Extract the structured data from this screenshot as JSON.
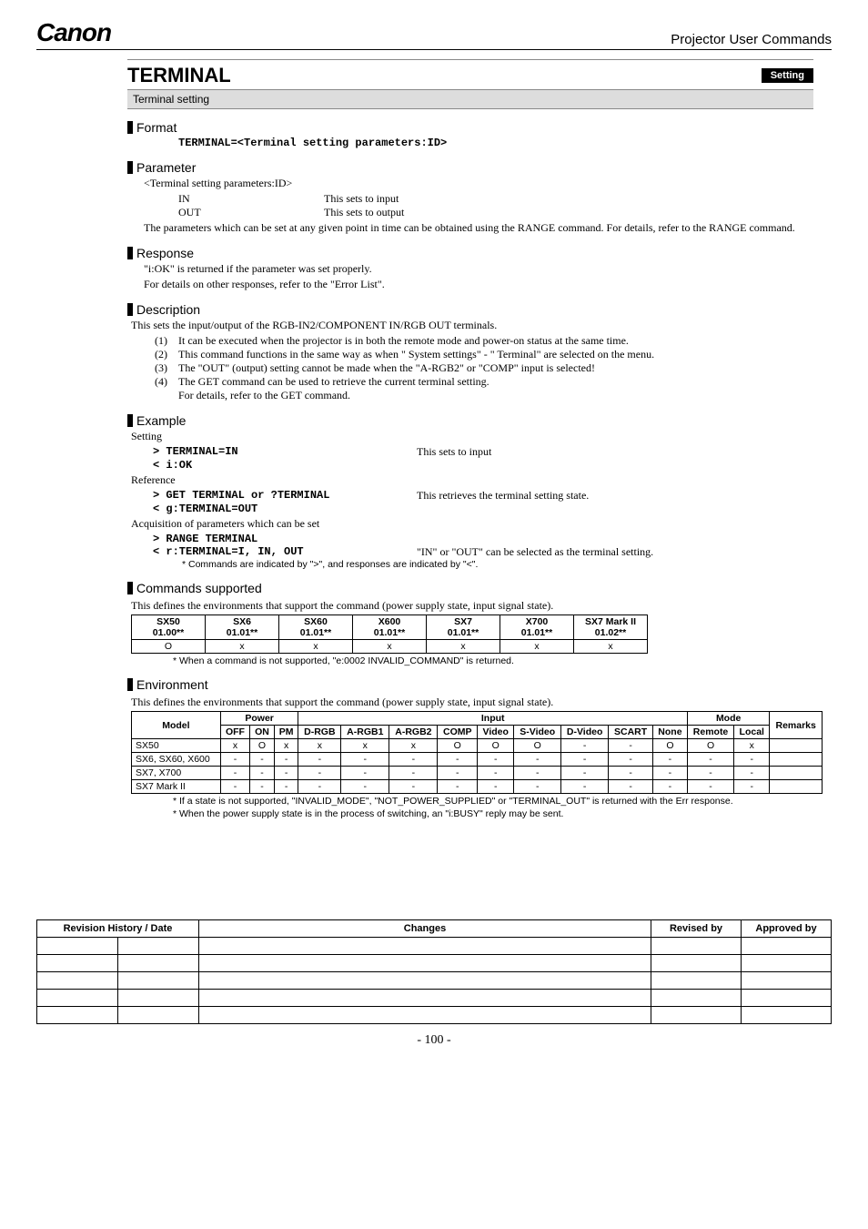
{
  "header": {
    "brand": "Canon",
    "docTitle": "Projector User Commands"
  },
  "titleBar": {
    "title": "TERMINAL",
    "badge": "Setting"
  },
  "subtitle": "Terminal setting",
  "format": {
    "heading": "Format",
    "code": "TERMINAL=<Terminal setting parameters:ID>"
  },
  "parameter": {
    "heading": "Parameter",
    "lead": "<Terminal setting parameters:ID>",
    "rows": [
      {
        "k": "IN",
        "v": "This sets to input"
      },
      {
        "k": "OUT",
        "v": "This sets to output"
      }
    ],
    "note": "The parameters which can be set at any given point in time can be obtained using the RANGE command. For details, refer to the RANGE command."
  },
  "response": {
    "heading": "Response",
    "l1": "\"i:OK\" is returned if the parameter was set properly.",
    "l2": "For details on other responses, refer to the \"Error List\"."
  },
  "description": {
    "heading": "Description",
    "lead": "This sets the input/output of the RGB-IN2/COMPONENT IN/RGB OUT terminals.",
    "items": [
      "It can be executed when the projector is in both the remote mode and power-on status at the same time.",
      "This command functions in the same way as when \" System settings\" - \" Terminal\" are selected on the menu.",
      "The \"OUT\" (output) setting cannot be made when the \"A-RGB2\" or \"COMP\" input is selected!",
      "The GET command can be used to retrieve the current terminal setting.\nFor details, refer to the GET command."
    ]
  },
  "example": {
    "heading": "Example",
    "settingLabel": "Setting",
    "set1cmd": "> TERMINAL=IN",
    "set1desc": "This sets to input",
    "set1resp": "< i:OK",
    "refLabel": "Reference",
    "ref1cmd": "> GET TERMINAL or ?TERMINAL",
    "ref1desc": "This retrieves the terminal setting state.",
    "ref1resp": "< g:TERMINAL=OUT",
    "acqLabel": "Acquisition of parameters which can be set",
    "acq1cmd": "> RANGE TERMINAL",
    "acq1resp": "< r:TERMINAL=I, IN, OUT",
    "acq1desc": "\"IN\" or \"OUT\" can be selected as the terminal setting.",
    "footnote": "*  Commands are indicated by \">\", and responses are indicated by \"<\"."
  },
  "commands": {
    "heading": "Commands supported",
    "caption": "This defines the environments that support the command (power supply state, input signal state).",
    "headers": [
      "SX50\n01.00**",
      "SX6\n01.01**",
      "SX60\n01.01**",
      "X600\n01.01**",
      "SX7\n01.01**",
      "X700\n01.01**",
      "SX7 Mark II\n01.02**"
    ],
    "row": [
      "O",
      "x",
      "x",
      "x",
      "x",
      "x",
      "x"
    ],
    "note": "*   When a command is not supported, \"e:0002 INVALID_COMMAND\" is returned."
  },
  "environment": {
    "heading": "Environment",
    "caption": "This defines the environments that support the command (power supply state, input signal state).",
    "group1": "Power",
    "group2": "Input",
    "group3": "Mode",
    "colModel": "Model",
    "colRemarks": "Remarks",
    "powerCols": [
      "OFF",
      "ON",
      "PM"
    ],
    "inputCols": [
      "D-RGB",
      "A-RGB1",
      "A-RGB2",
      "COMP",
      "Video",
      "S-Video",
      "D-Video",
      "SCART",
      "None"
    ],
    "modeCols": [
      "Remote",
      "Local"
    ],
    "rows": [
      {
        "model": "SX50",
        "cells": [
          "x",
          "O",
          "x",
          "x",
          "x",
          "x",
          "O",
          "O",
          "O",
          "-",
          "-",
          "O",
          "O",
          "x"
        ]
      },
      {
        "model": "SX6, SX60, X600",
        "cells": [
          "-",
          "-",
          "-",
          "-",
          "-",
          "-",
          "-",
          "-",
          "-",
          "-",
          "-",
          "-",
          "-",
          "-"
        ]
      },
      {
        "model": "SX7, X700",
        "cells": [
          "-",
          "-",
          "-",
          "-",
          "-",
          "-",
          "-",
          "-",
          "-",
          "-",
          "-",
          "-",
          "-",
          "-"
        ]
      },
      {
        "model": "SX7 Mark II",
        "cells": [
          "-",
          "-",
          "-",
          "-",
          "-",
          "-",
          "-",
          "-",
          "-",
          "-",
          "-",
          "-",
          "-",
          "-"
        ]
      }
    ],
    "note1": "*   If a state is not supported, \"INVALID_MODE\", \"NOT_POWER_SUPPLIED\" or \"TERMINAL_OUT\" is returned with the Err response.",
    "note2": "*   When the power supply state is in the process of switching, an \"i:BUSY\" reply may be sent."
  },
  "revTable": {
    "h1": "Revision History / Date",
    "h2": "Changes",
    "h3": "Revised by",
    "h4": "Approved by"
  },
  "pageNum": "- 100 -"
}
